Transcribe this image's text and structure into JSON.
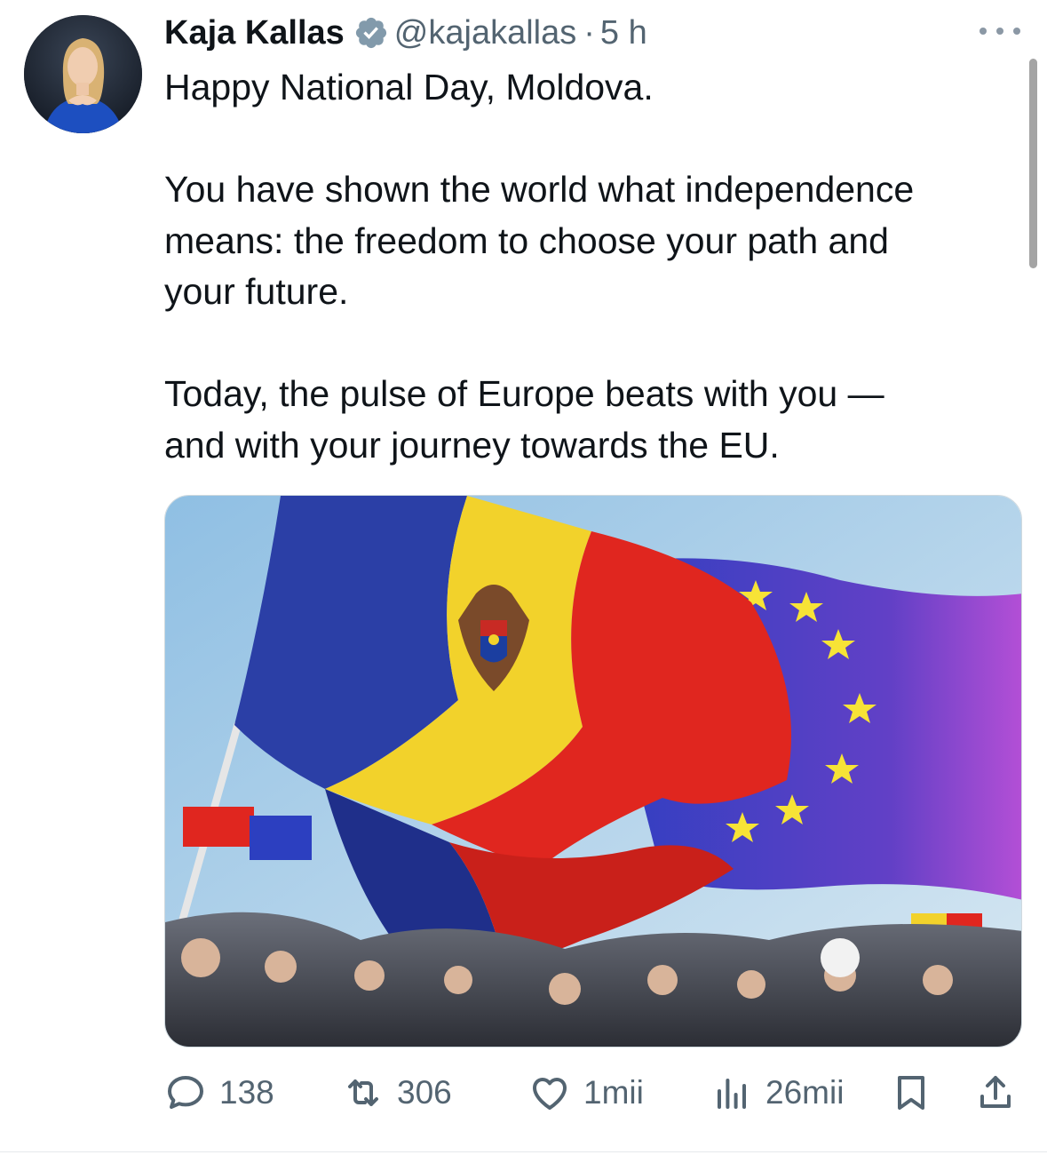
{
  "tweet": {
    "author_name": "Kaja Kallas",
    "handle": "@kajakallas",
    "separator": "·",
    "time": "5 h",
    "lines": [
      "Happy National Day, Moldova.",
      "You have shown the world what independence",
      "means: the freedom to choose your path and",
      "your future.",
      "Today, the pulse of Europe beats with you —",
      "and with your journey towards the EU."
    ]
  },
  "actions": {
    "replies": "138",
    "reposts": "306",
    "likes": "1mii",
    "views": "26mii"
  },
  "icons": {
    "verified": "verified-badge-icon",
    "more": "more-horizontal-icon",
    "reply": "reply-bubble-icon",
    "repost": "repost-icon",
    "like": "heart-icon",
    "views": "bar-chart-icon",
    "bookmark": "bookmark-icon",
    "share": "share-icon"
  },
  "colors": {
    "text": "#0f1419",
    "secondary": "#536471",
    "verified_badge": "#829aab"
  }
}
